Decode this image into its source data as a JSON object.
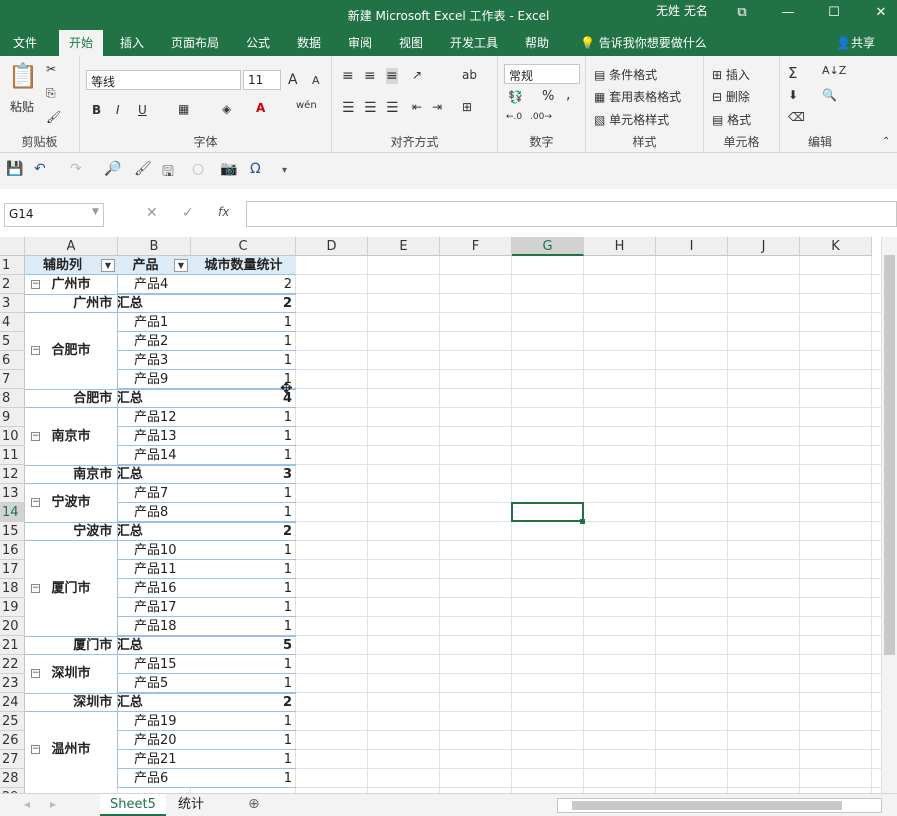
{
  "window": {
    "title": "新建 Microsoft Excel 工作表  -  Excel",
    "user": "无姓 无名",
    "minimize": "—",
    "maximize": "☐",
    "close": "✕",
    "restore": "⧉"
  },
  "ribbon_tabs": [
    "文件",
    "开始",
    "插入",
    "页面布局",
    "公式",
    "数据",
    "审阅",
    "视图",
    "开发工具",
    "帮助"
  ],
  "active_tab": "开始",
  "tell_me": "告诉我你想要做什么",
  "share": "共享",
  "ribbon": {
    "clipboard": {
      "label": "剪贴板",
      "paste": "粘贴"
    },
    "font": {
      "label": "字体",
      "font_name": "等线",
      "font_size": "11",
      "bold": "B",
      "italic": "I",
      "underline": "U",
      "grow": "A",
      "shrink": "A",
      "wen": "wén"
    },
    "alignment": {
      "label": "对齐方式",
      "wrap": "ab"
    },
    "number": {
      "label": "数字",
      "format": "常规",
      "percent": "%",
      "comma": ","
    },
    "styles": {
      "label": "样式",
      "conditional": "条件格式",
      "table": "套用表格格式",
      "cell_styles": "单元格样式"
    },
    "cells": {
      "label": "单元格",
      "insert": "插入",
      "delete": "删除",
      "format": "格式"
    },
    "editing": {
      "label": "编辑"
    }
  },
  "formula_bar": {
    "name_box": "G14",
    "fx": "fx",
    "formula": ""
  },
  "columns": [
    "A",
    "B",
    "C",
    "D",
    "E",
    "F",
    "G",
    "H",
    "I",
    "J",
    "K"
  ],
  "selected_cell": "G14",
  "pivot": {
    "headers": [
      "辅助列",
      "产品",
      "城市数量统计"
    ],
    "rows": [
      {
        "row": 2,
        "city": "广州市",
        "product": "产品4",
        "value": "2"
      },
      {
        "row": 3,
        "subtotal": "广州市 汇总",
        "value": "2"
      },
      {
        "row": 4,
        "city": "合肥市",
        "product": "产品1",
        "value": "1"
      },
      {
        "row": 5,
        "product": "产品2",
        "value": "1"
      },
      {
        "row": 6,
        "product": "产品3",
        "value": "1"
      },
      {
        "row": 7,
        "product": "产品9",
        "value": "1"
      },
      {
        "row": 8,
        "subtotal": "合肥市 汇总",
        "value": "4"
      },
      {
        "row": 9,
        "city": "南京市",
        "product": "产品12",
        "value": "1"
      },
      {
        "row": 10,
        "product": "产品13",
        "value": "1"
      },
      {
        "row": 11,
        "product": "产品14",
        "value": "1"
      },
      {
        "row": 12,
        "subtotal": "南京市 汇总",
        "value": "3"
      },
      {
        "row": 13,
        "city": "宁波市",
        "product": "产品7",
        "value": "1"
      },
      {
        "row": 14,
        "product": "产品8",
        "value": "1"
      },
      {
        "row": 15,
        "subtotal": "宁波市 汇总",
        "value": "2"
      },
      {
        "row": 16,
        "city": "厦门市",
        "product": "产品10",
        "value": "1"
      },
      {
        "row": 17,
        "product": "产品11",
        "value": "1"
      },
      {
        "row": 18,
        "product": "产品16",
        "value": "1"
      },
      {
        "row": 19,
        "product": "产品17",
        "value": "1"
      },
      {
        "row": 20,
        "product": "产品18",
        "value": "1"
      },
      {
        "row": 21,
        "subtotal": "厦门市 汇总",
        "value": "5"
      },
      {
        "row": 22,
        "city": "深圳市",
        "product": "产品15",
        "value": "1"
      },
      {
        "row": 23,
        "product": "产品5",
        "value": "1"
      },
      {
        "row": 24,
        "subtotal": "深圳市 汇总",
        "value": "2"
      },
      {
        "row": 25,
        "city": "温州市",
        "product": "产品19",
        "value": "1"
      },
      {
        "row": 26,
        "product": "产品20",
        "value": "1"
      },
      {
        "row": 27,
        "product": "产品21",
        "value": "1"
      },
      {
        "row": 28,
        "product": "产品6",
        "value": "1"
      }
    ]
  },
  "sheets": [
    "Sheet5",
    "统计"
  ],
  "active_sheet": "Sheet5",
  "accent": "#217346",
  "pivot_header_fill": "#ddebf7"
}
